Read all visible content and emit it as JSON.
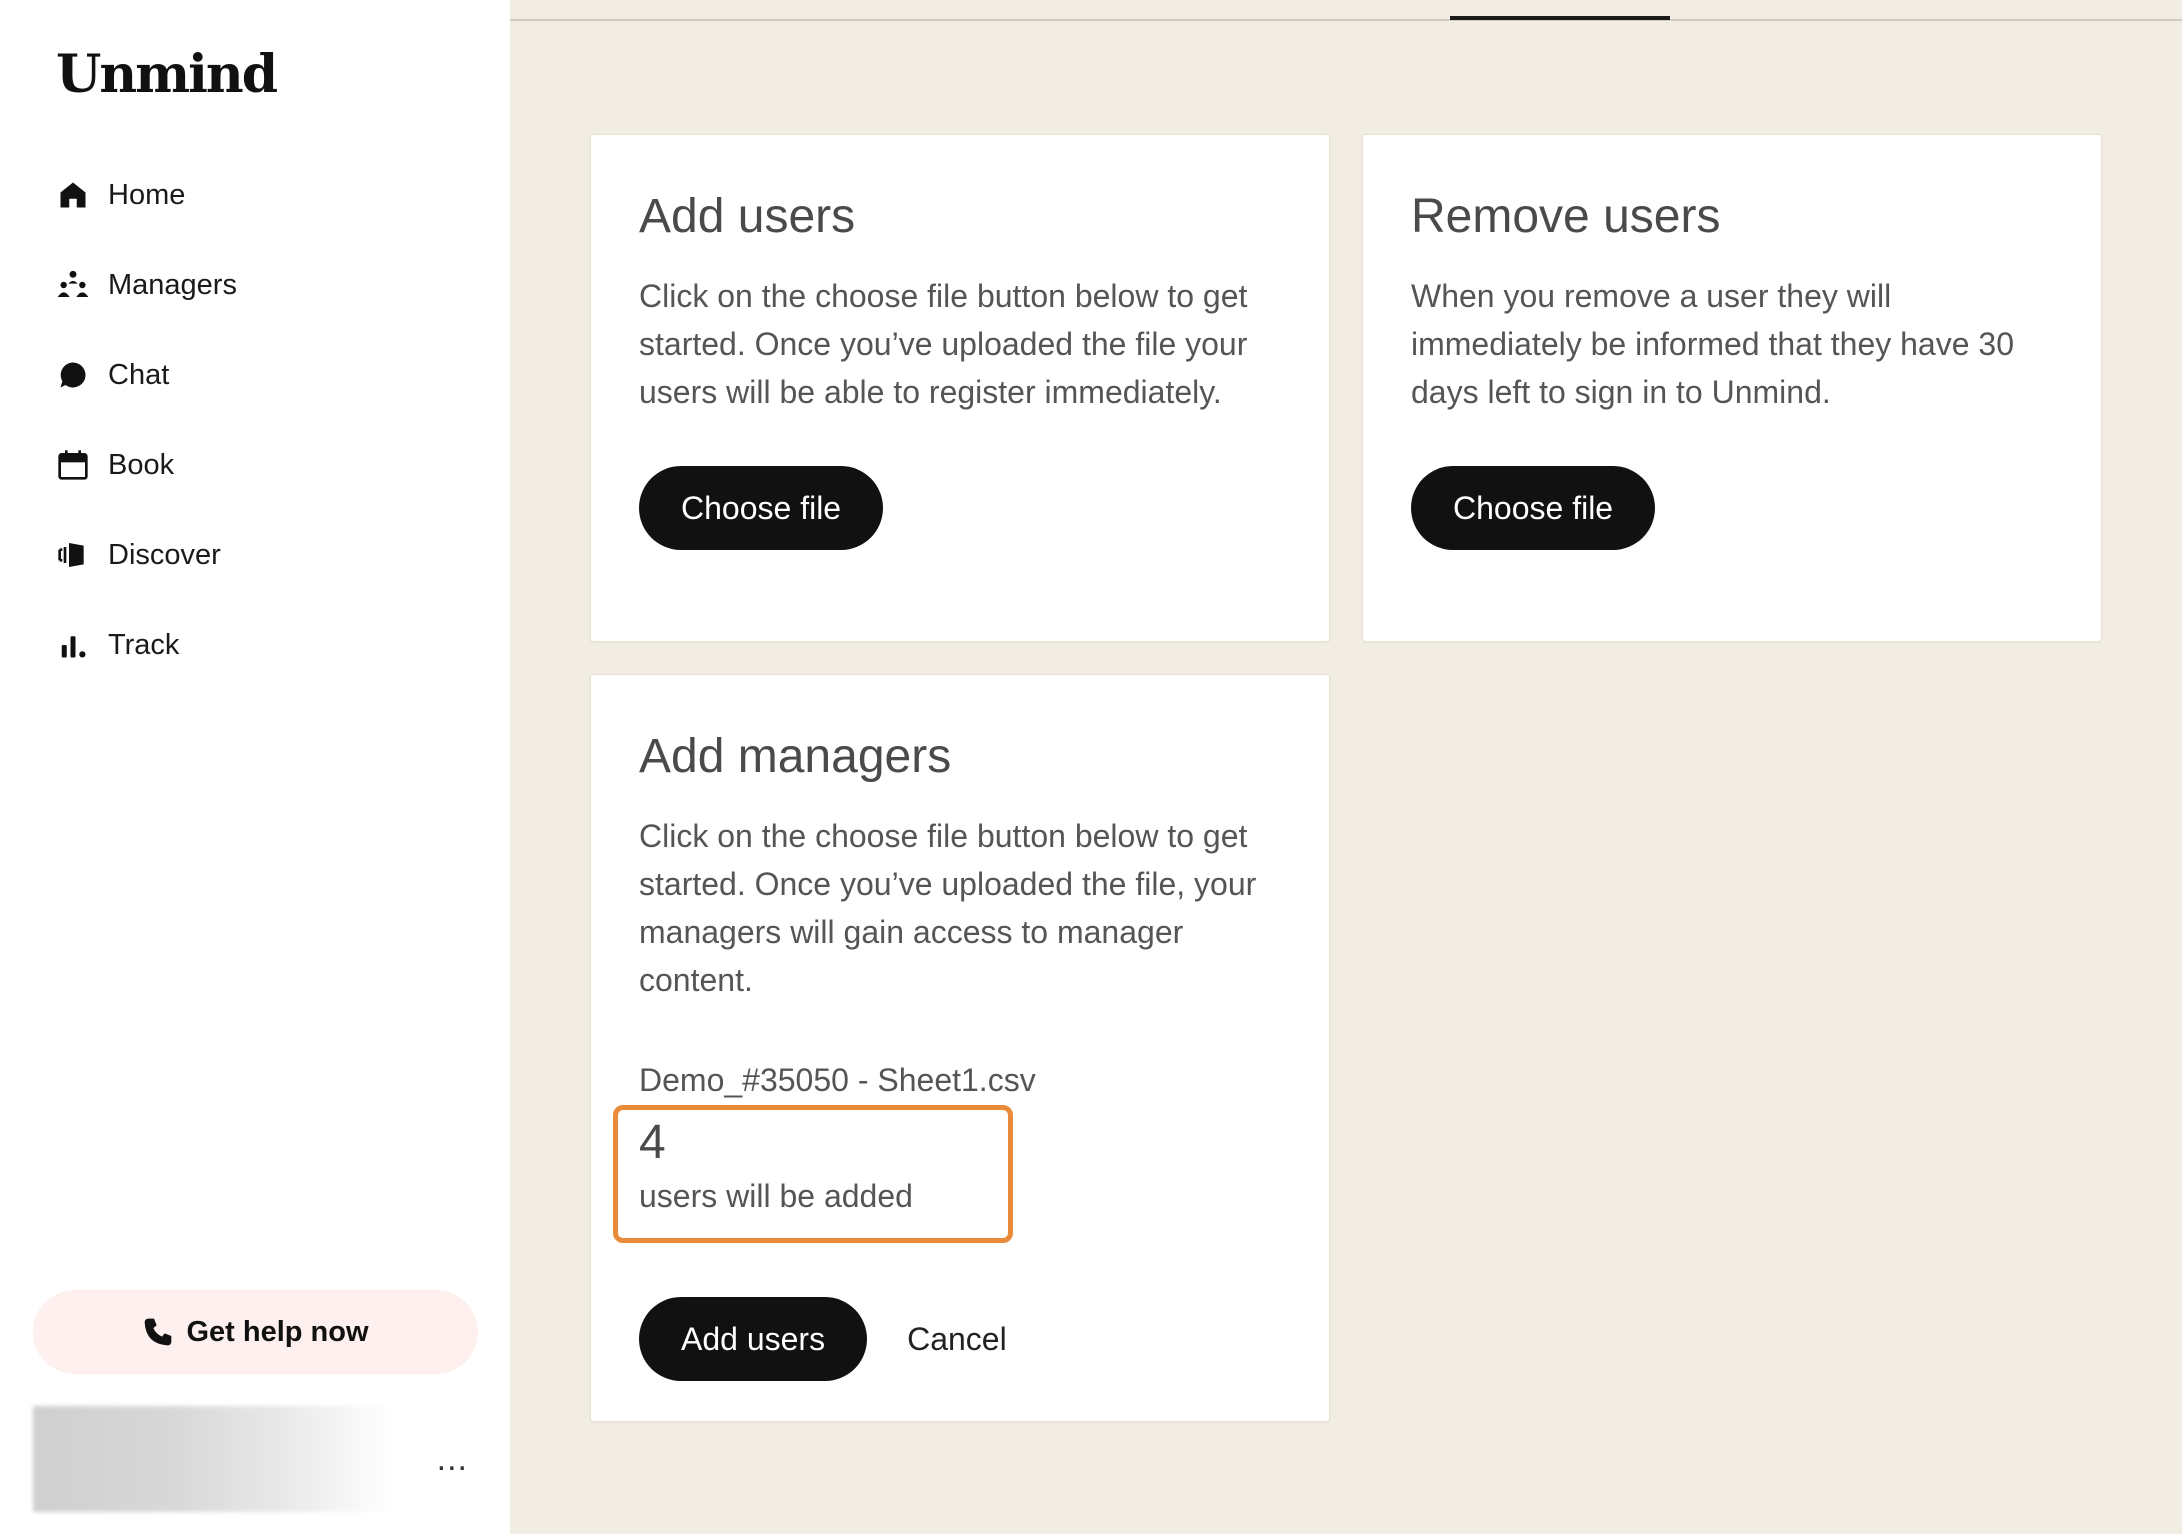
{
  "app": {
    "logo": "Unmind"
  },
  "sidebar": {
    "items": [
      {
        "label": "Home",
        "icon": "home-icon"
      },
      {
        "label": "Managers",
        "icon": "managers-icon"
      },
      {
        "label": "Chat",
        "icon": "chat-icon"
      },
      {
        "label": "Book",
        "icon": "calendar-icon"
      },
      {
        "label": "Discover",
        "icon": "discover-icon"
      },
      {
        "label": "Track",
        "icon": "chart-icon"
      }
    ],
    "help_label": "Get help now",
    "more_label": "..."
  },
  "cards": {
    "add_users": {
      "title": "Add users",
      "description": "Click on the choose file button below to get started. Once you’ve uploaded the file your users will be able to register immediately.",
      "button": "Choose file"
    },
    "remove_users": {
      "title": "Remove users",
      "description": "When you remove a user they will immediately be informed that they have 30 days left to sign in to Unmind.",
      "button": "Choose file"
    },
    "add_managers": {
      "title": "Add managers",
      "description": "Click on the choose file button below to get started. Once you’ve uploaded the file, your managers will gain access to manager content.",
      "filename": "Demo_#35050 - Sheet1.csv",
      "count": "4",
      "count_label": "users will be added",
      "submit": "Add users",
      "cancel": "Cancel"
    }
  },
  "colors": {
    "background": "#f1ede3",
    "highlight": "#e98b3a",
    "button": "#111111",
    "help_bg": "#fdf0ee"
  }
}
